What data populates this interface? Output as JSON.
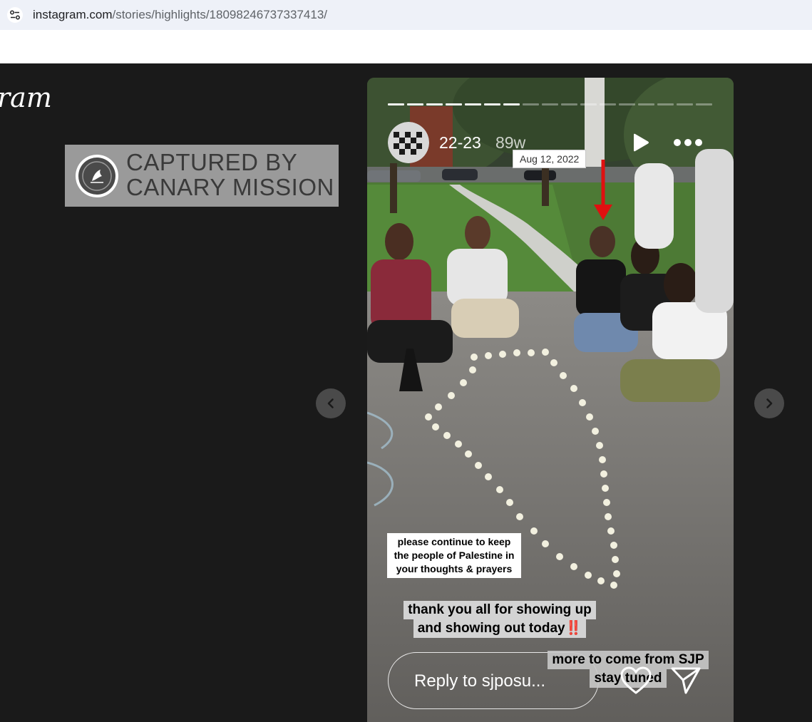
{
  "browser": {
    "url_host": "instagram.com",
    "url_path": "/stories/highlights/18098246737337413/"
  },
  "page": {
    "logo_fragment": "ram",
    "watermark": {
      "line1": "CAPTURED BY",
      "line2": "CANARY MISSION"
    }
  },
  "story": {
    "progress_total": 17,
    "progress_done": 7,
    "title": "22-23",
    "time_ago": "89w",
    "date_tooltip": "Aug 12, 2022",
    "captions": {
      "caption1": [
        "please continue to keep",
        "the people of Palestine in",
        "your thoughts & prayers"
      ],
      "caption2_line1": "thank you all for showing up",
      "caption2_line2": "and showing out today",
      "caption2_emoji": "‼️",
      "caption3_line1": "more to come from SJP",
      "caption3_line2": "stay tuned"
    },
    "reply_placeholder": "Reply to sjposu..."
  },
  "icons": {
    "site_info": "tune-icon",
    "prev": "chevron-left-icon",
    "next": "chevron-right-icon",
    "play": "play-icon",
    "more": "more-horizontal-icon",
    "like": "heart-icon",
    "share": "send-icon"
  },
  "colors": {
    "page_bg": "#1a1a1a",
    "urlbar_bg": "#eef1f8",
    "watermark_bg": "#9a9a9a",
    "arrow_red": "#e01010"
  }
}
